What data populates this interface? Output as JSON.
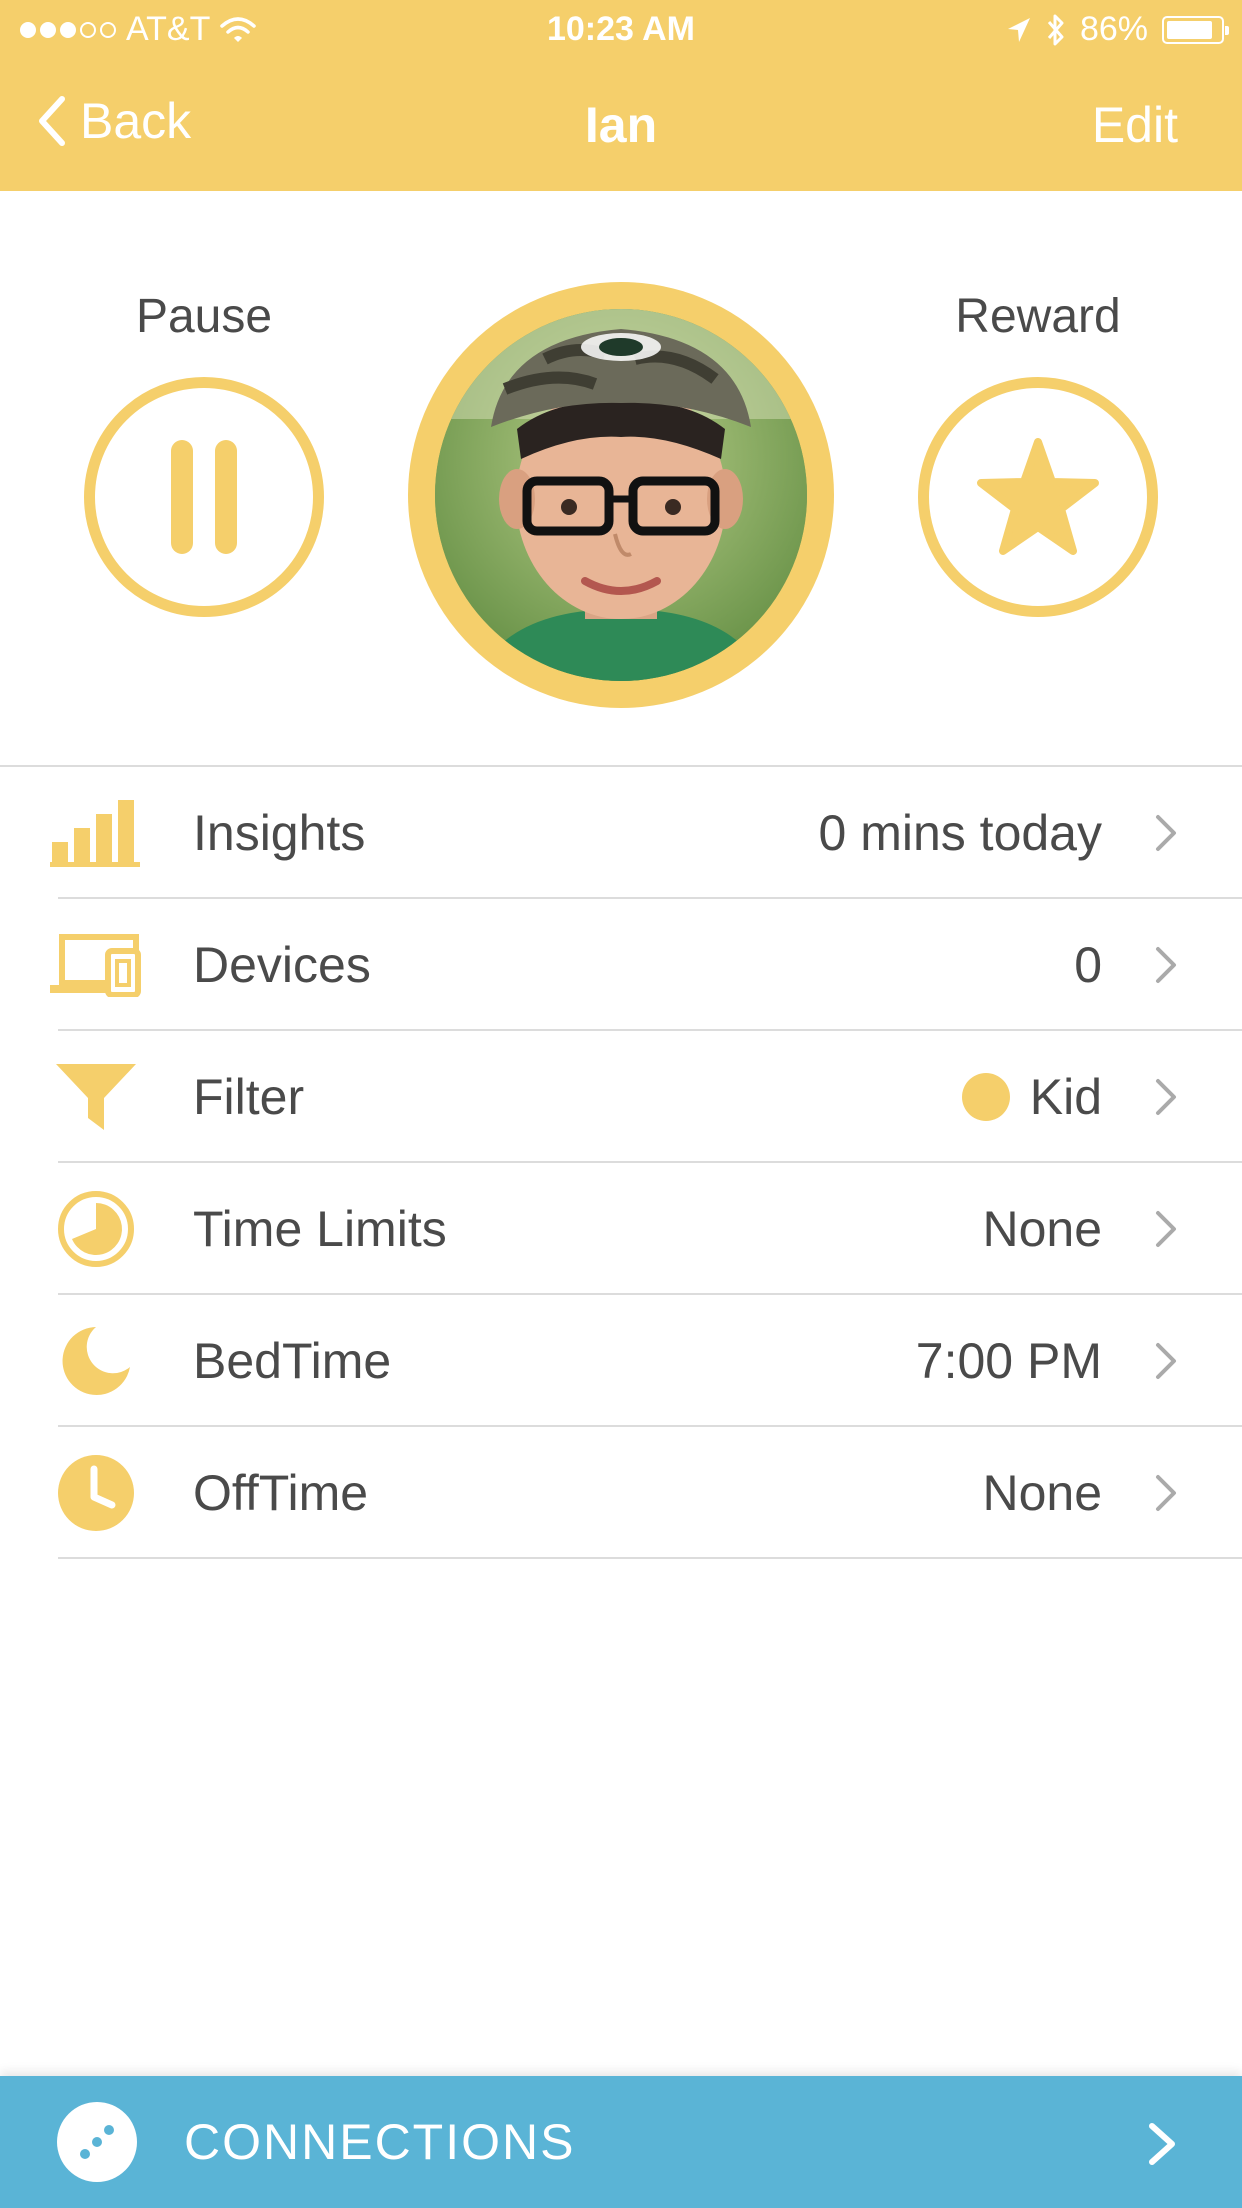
{
  "status_bar": {
    "carrier": "AT&T",
    "time": "10:23 AM",
    "battery": "86%",
    "battery_level": 0.86,
    "signal_bars": 3,
    "signal_total": 5
  },
  "nav": {
    "back_label": "Back",
    "title": "Ian",
    "edit_label": "Edit"
  },
  "actions": {
    "pause_label": "Pause",
    "reward_label": "Reward"
  },
  "menu": {
    "insights": {
      "label": "Insights",
      "value": "0 mins today",
      "icon": "bar-chart-icon"
    },
    "devices": {
      "label": "Devices",
      "value": "0",
      "icon": "devices-icon"
    },
    "filter": {
      "label": "Filter",
      "value": "Kid",
      "icon": "funnel-icon"
    },
    "time_limits": {
      "label": "Time Limits",
      "value": "None",
      "icon": "timer-icon"
    },
    "bedtime": {
      "label": "BedTime",
      "value": "7:00 PM",
      "icon": "moon-icon"
    },
    "offtime": {
      "label": "OffTime",
      "value": "None",
      "icon": "clock-icon"
    }
  },
  "footer": {
    "label": "CONNECTIONS",
    "icon": "connections-icon"
  },
  "colors": {
    "accent_yellow": "#f5cf6b",
    "connections_blue": "#5ab4d6",
    "text": "#4a4a4a",
    "divider": "#dcdcdc"
  }
}
